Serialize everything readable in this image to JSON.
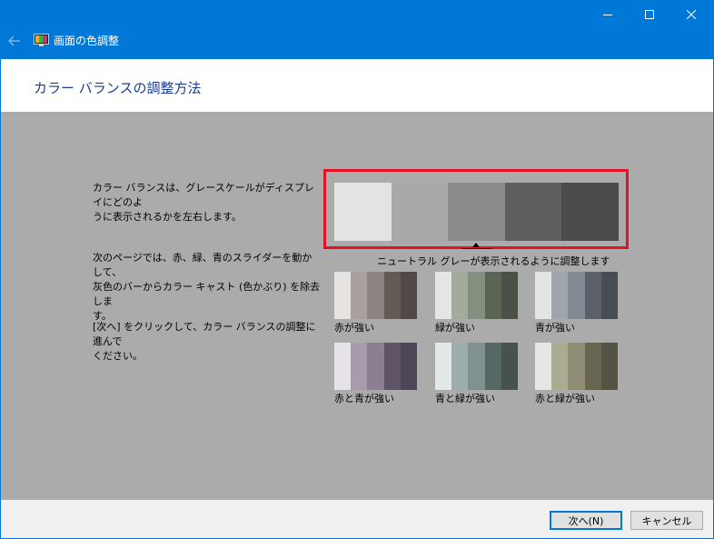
{
  "window": {
    "title": "画面の色調整",
    "icons": {
      "back": "back-arrow-icon",
      "app": "monitor-color-icon",
      "minimize": "minimize-icon",
      "maximize": "maximize-icon",
      "close": "close-icon"
    }
  },
  "header": {
    "title": "カラー バランスの調整方法"
  },
  "instructions": {
    "p1": [
      "カラー バランスは、グレースケールがディスプレイにどのよ",
      "うに表示されるかを左右します。"
    ],
    "p2": [
      "次のページでは、赤、緑、青のスライダーを動かして、",
      "灰色のバーからカラー キャスト (色かぶり) を除去しま",
      "す。"
    ],
    "p3": [
      "[次へ] をクリックして、カラー バランスの調整に進んで",
      "ください。"
    ]
  },
  "reference": {
    "caption": "ニュートラル グレーが表示されるように調整します",
    "colors": [
      "#e3e3e3",
      "#a8a8a8",
      "#8b8b8b",
      "#5e5e5e",
      "#4b4b4b"
    ],
    "highlight_color": "#e81123"
  },
  "samples": [
    {
      "label": "赤が強い",
      "colors": [
        "#e6e3e3",
        "#aaa09f",
        "#8e8482",
        "#635955",
        "#514947"
      ]
    },
    {
      "label": "緑が強い",
      "colors": [
        "#e3e6e3",
        "#a3ab9f",
        "#84907f",
        "#5a6653",
        "#4a5247"
      ]
    },
    {
      "label": "青が強い",
      "colors": [
        "#e3e4e6",
        "#a0a6ab",
        "#838b92",
        "#5a616a",
        "#484c53"
      ]
    },
    {
      "label": "赤と青が強い",
      "colors": [
        "#e6e3e8",
        "#a79cac",
        "#8c7f91",
        "#5d5466",
        "#4e4656"
      ]
    },
    {
      "label": "青と緑が強い",
      "colors": [
        "#e3e8e8",
        "#9dadac",
        "#80918f",
        "#566764",
        "#47524f"
      ]
    },
    {
      "label": "赤と緑が強い",
      "colors": [
        "#e6e6e2",
        "#abaa92",
        "#8f8d74",
        "#686650",
        "#555343"
      ]
    }
  ],
  "footer": {
    "next_label": "次へ(N)",
    "cancel_label": "キャンセル"
  }
}
